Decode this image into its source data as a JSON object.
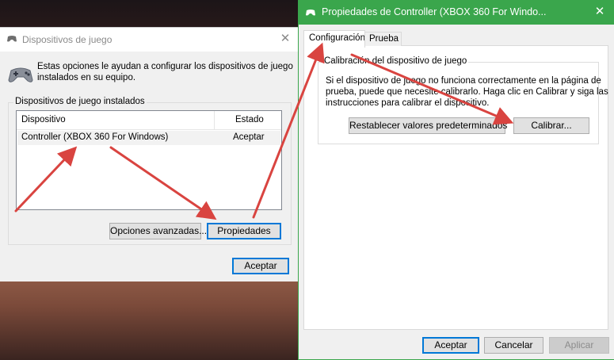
{
  "left_window": {
    "title": "Dispositivos de juego",
    "description_line1": "Estas opciones le ayudan a configurar los dispositivos de juego",
    "description_line2": "instalados en su equipo.",
    "group_label": "Dispositivos de juego instalados",
    "table": {
      "headers": [
        "Dispositivo",
        "Estado"
      ],
      "rows": [
        [
          "Controller (XBOX 360 For Windows)",
          "Aceptar"
        ]
      ]
    },
    "advanced_button": "Opciones avanzadas...",
    "properties_button": "Propiedades",
    "ok_button": "Aceptar"
  },
  "right_window": {
    "title": "Propiedades de Controller (XBOX 360 For Windo...",
    "tabs": [
      "Configuración",
      "Prueba"
    ],
    "group_label": "Calibración del dispositivo de juego",
    "text_line1": "Si el dispositivo de juego no funciona correctamente en la página de",
    "text_line2": "prueba, puede que necesite calibrarlo.  Haga clic en Calibrar y siga las",
    "text_line3": "instrucciones para calibrar el dispositivo.",
    "reset_button": "Restablecer valores predeterminados",
    "calibrate_button": "Calibrar...",
    "ok_button": "Aceptar",
    "cancel_button": "Cancelar",
    "apply_button": "Aplicar"
  },
  "colors": {
    "arrow": "#d94440",
    "accent": "#0078d7",
    "window_border_active": "#3aa64c"
  }
}
